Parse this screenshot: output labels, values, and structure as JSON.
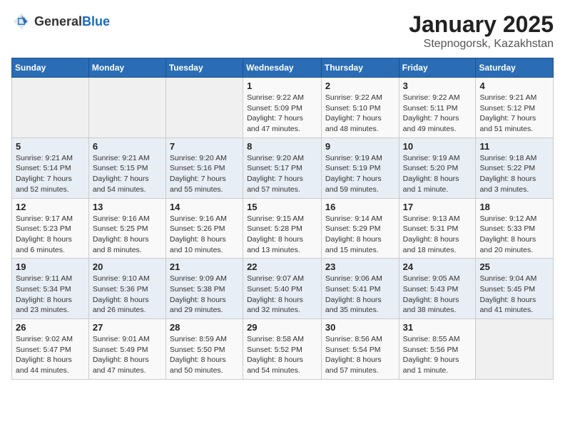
{
  "header": {
    "logo_general": "General",
    "logo_blue": "Blue",
    "month": "January 2025",
    "location": "Stepnogorsk, Kazakhstan"
  },
  "weekdays": [
    "Sunday",
    "Monday",
    "Tuesday",
    "Wednesday",
    "Thursday",
    "Friday",
    "Saturday"
  ],
  "weeks": [
    [
      {
        "day": "",
        "info": ""
      },
      {
        "day": "",
        "info": ""
      },
      {
        "day": "",
        "info": ""
      },
      {
        "day": "1",
        "info": "Sunrise: 9:22 AM\nSunset: 5:09 PM\nDaylight: 7 hours and 47 minutes."
      },
      {
        "day": "2",
        "info": "Sunrise: 9:22 AM\nSunset: 5:10 PM\nDaylight: 7 hours and 48 minutes."
      },
      {
        "day": "3",
        "info": "Sunrise: 9:22 AM\nSunset: 5:11 PM\nDaylight: 7 hours and 49 minutes."
      },
      {
        "day": "4",
        "info": "Sunrise: 9:21 AM\nSunset: 5:12 PM\nDaylight: 7 hours and 51 minutes."
      }
    ],
    [
      {
        "day": "5",
        "info": "Sunrise: 9:21 AM\nSunset: 5:14 PM\nDaylight: 7 hours and 52 minutes."
      },
      {
        "day": "6",
        "info": "Sunrise: 9:21 AM\nSunset: 5:15 PM\nDaylight: 7 hours and 54 minutes."
      },
      {
        "day": "7",
        "info": "Sunrise: 9:20 AM\nSunset: 5:16 PM\nDaylight: 7 hours and 55 minutes."
      },
      {
        "day": "8",
        "info": "Sunrise: 9:20 AM\nSunset: 5:17 PM\nDaylight: 7 hours and 57 minutes."
      },
      {
        "day": "9",
        "info": "Sunrise: 9:19 AM\nSunset: 5:19 PM\nDaylight: 7 hours and 59 minutes."
      },
      {
        "day": "10",
        "info": "Sunrise: 9:19 AM\nSunset: 5:20 PM\nDaylight: 8 hours and 1 minute."
      },
      {
        "day": "11",
        "info": "Sunrise: 9:18 AM\nSunset: 5:22 PM\nDaylight: 8 hours and 3 minutes."
      }
    ],
    [
      {
        "day": "12",
        "info": "Sunrise: 9:17 AM\nSunset: 5:23 PM\nDaylight: 8 hours and 6 minutes."
      },
      {
        "day": "13",
        "info": "Sunrise: 9:16 AM\nSunset: 5:25 PM\nDaylight: 8 hours and 8 minutes."
      },
      {
        "day": "14",
        "info": "Sunrise: 9:16 AM\nSunset: 5:26 PM\nDaylight: 8 hours and 10 minutes."
      },
      {
        "day": "15",
        "info": "Sunrise: 9:15 AM\nSunset: 5:28 PM\nDaylight: 8 hours and 13 minutes."
      },
      {
        "day": "16",
        "info": "Sunrise: 9:14 AM\nSunset: 5:29 PM\nDaylight: 8 hours and 15 minutes."
      },
      {
        "day": "17",
        "info": "Sunrise: 9:13 AM\nSunset: 5:31 PM\nDaylight: 8 hours and 18 minutes."
      },
      {
        "day": "18",
        "info": "Sunrise: 9:12 AM\nSunset: 5:33 PM\nDaylight: 8 hours and 20 minutes."
      }
    ],
    [
      {
        "day": "19",
        "info": "Sunrise: 9:11 AM\nSunset: 5:34 PM\nDaylight: 8 hours and 23 minutes."
      },
      {
        "day": "20",
        "info": "Sunrise: 9:10 AM\nSunset: 5:36 PM\nDaylight: 8 hours and 26 minutes."
      },
      {
        "day": "21",
        "info": "Sunrise: 9:09 AM\nSunset: 5:38 PM\nDaylight: 8 hours and 29 minutes."
      },
      {
        "day": "22",
        "info": "Sunrise: 9:07 AM\nSunset: 5:40 PM\nDaylight: 8 hours and 32 minutes."
      },
      {
        "day": "23",
        "info": "Sunrise: 9:06 AM\nSunset: 5:41 PM\nDaylight: 8 hours and 35 minutes."
      },
      {
        "day": "24",
        "info": "Sunrise: 9:05 AM\nSunset: 5:43 PM\nDaylight: 8 hours and 38 minutes."
      },
      {
        "day": "25",
        "info": "Sunrise: 9:04 AM\nSunset: 5:45 PM\nDaylight: 8 hours and 41 minutes."
      }
    ],
    [
      {
        "day": "26",
        "info": "Sunrise: 9:02 AM\nSunset: 5:47 PM\nDaylight: 8 hours and 44 minutes."
      },
      {
        "day": "27",
        "info": "Sunrise: 9:01 AM\nSunset: 5:49 PM\nDaylight: 8 hours and 47 minutes."
      },
      {
        "day": "28",
        "info": "Sunrise: 8:59 AM\nSunset: 5:50 PM\nDaylight: 8 hours and 50 minutes."
      },
      {
        "day": "29",
        "info": "Sunrise: 8:58 AM\nSunset: 5:52 PM\nDaylight: 8 hours and 54 minutes."
      },
      {
        "day": "30",
        "info": "Sunrise: 8:56 AM\nSunset: 5:54 PM\nDaylight: 8 hours and 57 minutes."
      },
      {
        "day": "31",
        "info": "Sunrise: 8:55 AM\nSunset: 5:56 PM\nDaylight: 9 hours and 1 minute."
      },
      {
        "day": "",
        "info": ""
      }
    ]
  ]
}
